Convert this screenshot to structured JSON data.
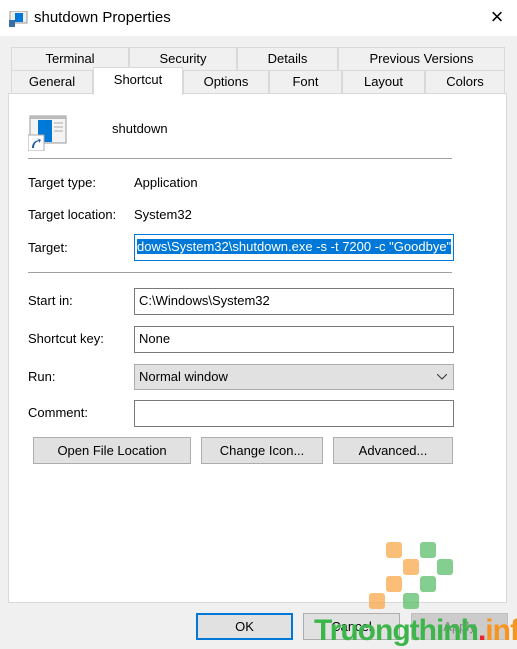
{
  "window": {
    "title": "shutdown Properties",
    "close": "×"
  },
  "tabs_row1": [
    "Terminal",
    "Security",
    "Details",
    "Previous Versions"
  ],
  "tabs_row2": [
    "General",
    "Shortcut",
    "Options",
    "Font",
    "Layout",
    "Colors"
  ],
  "selected_tab": "Shortcut",
  "shortcut": {
    "name": "shutdown",
    "target_type_label": "Target type:",
    "target_type": "Application",
    "target_location_label": "Target location:",
    "target_location": "System32",
    "target_label": "Target:",
    "target": "dows\\System32\\shutdown.exe -s -t 7200 -c \"Goodbye\"",
    "start_in_label": "Start in:",
    "start_in": "C:\\Windows\\System32",
    "shortcut_key_label": "Shortcut key:",
    "shortcut_key": "None",
    "run_label": "Run:",
    "run": "Normal window",
    "comment_label": "Comment:",
    "comment": "",
    "open_file_location": "Open File Location",
    "change_icon": "Change Icon...",
    "advanced": "Advanced..."
  },
  "footer": {
    "ok": "OK",
    "cancel": "Cancel",
    "apply": "Apply"
  },
  "watermark": {
    "text": "Truongthinh.info"
  },
  "colors": {
    "selection": "#0078d7",
    "accent_border": "#0078d7"
  }
}
